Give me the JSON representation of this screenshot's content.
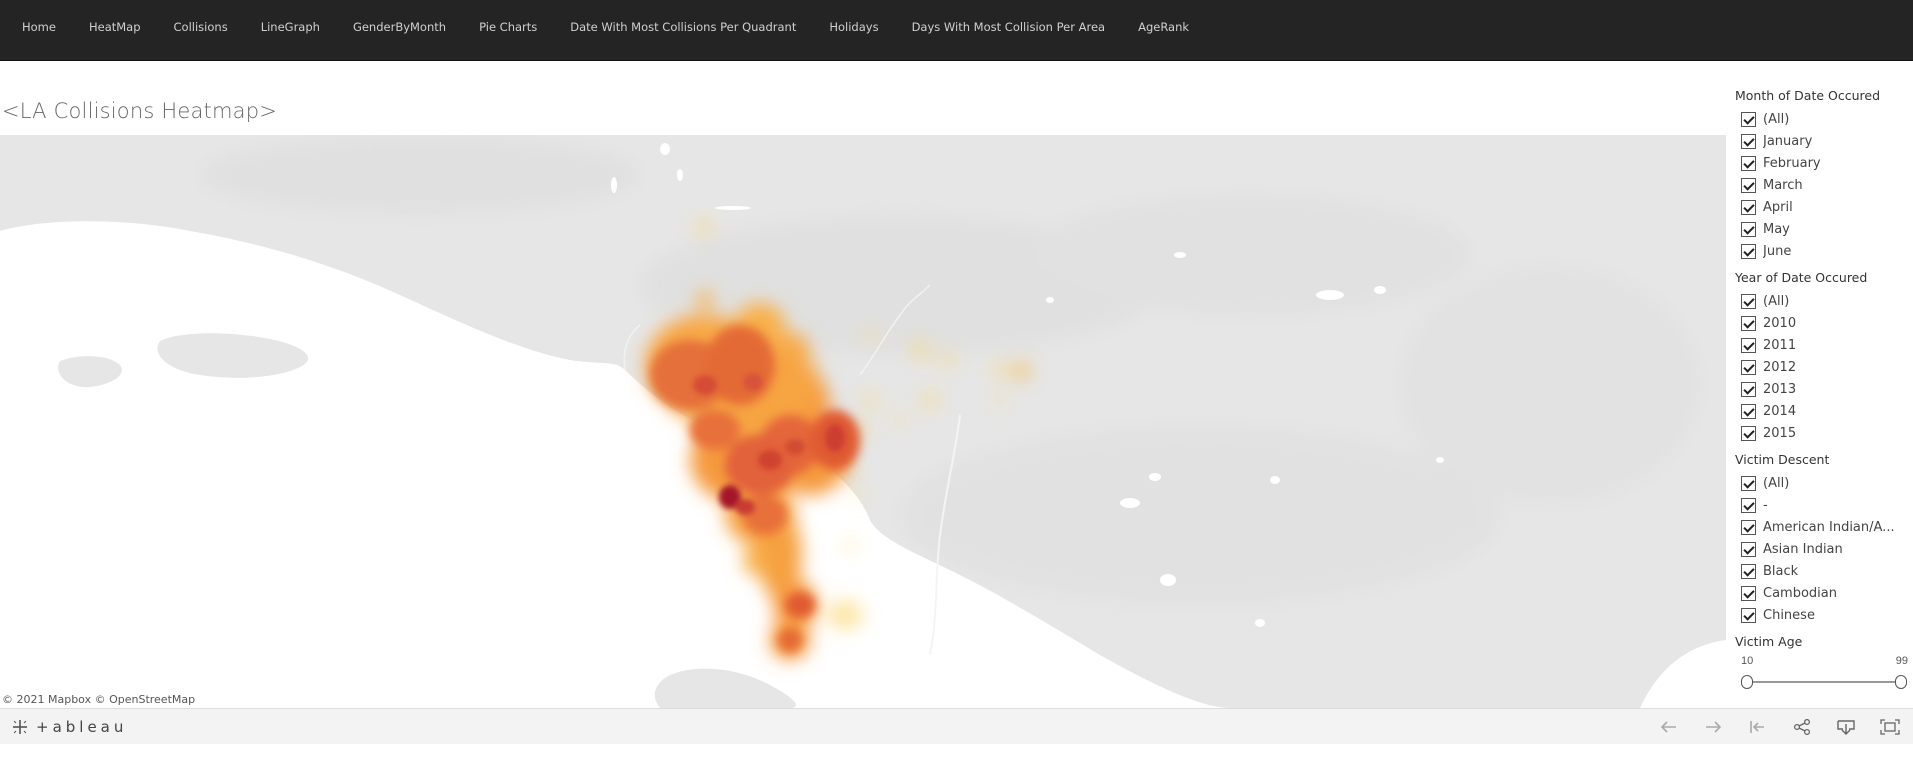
{
  "nav": {
    "items": [
      {
        "label": "Home"
      },
      {
        "label": "HeatMap"
      },
      {
        "label": "Collisions"
      },
      {
        "label": "LineGraph"
      },
      {
        "label": "GenderByMonth"
      },
      {
        "label": "Pie Charts"
      },
      {
        "label": "Date With Most Collisions Per Quadrant"
      },
      {
        "label": "Holidays"
      },
      {
        "label": "Days With Most Collision Per Area"
      },
      {
        "label": "AgeRank"
      }
    ]
  },
  "dashboard": {
    "title": "<LA Collisions Heatmap>",
    "attribution": "© 2021 Mapbox  © OpenStreetMap"
  },
  "filters": {
    "month": {
      "title": "Month of Date Occured",
      "options": [
        "(All)",
        "January",
        "February",
        "March",
        "April",
        "May",
        "June"
      ]
    },
    "year": {
      "title": "Year of Date Occured",
      "options": [
        "(All)",
        "2010",
        "2011",
        "2012",
        "2013",
        "2014",
        "2015"
      ]
    },
    "descent": {
      "title": "Victim Descent",
      "options": [
        "(All)",
        "-",
        "American Indian/A...",
        "Asian Indian",
        "Black",
        "Cambodian",
        "Chinese"
      ]
    },
    "age": {
      "title": "Victim Age",
      "min": "10",
      "max": "99"
    }
  },
  "toolbar": {
    "logo_text": "+ableau",
    "icons": [
      "undo-icon",
      "redo-icon",
      "revert-icon",
      "share-icon",
      "download-icon",
      "fullscreen-icon"
    ]
  },
  "colors": {
    "nav_bg": "#242424",
    "heat_low": "#fbd36a",
    "heat_mid": "#f39a3c",
    "heat_high": "#d9402a",
    "heat_peak": "#7d0f1e",
    "land": "#e6e6e6",
    "water": "#ffffff"
  }
}
